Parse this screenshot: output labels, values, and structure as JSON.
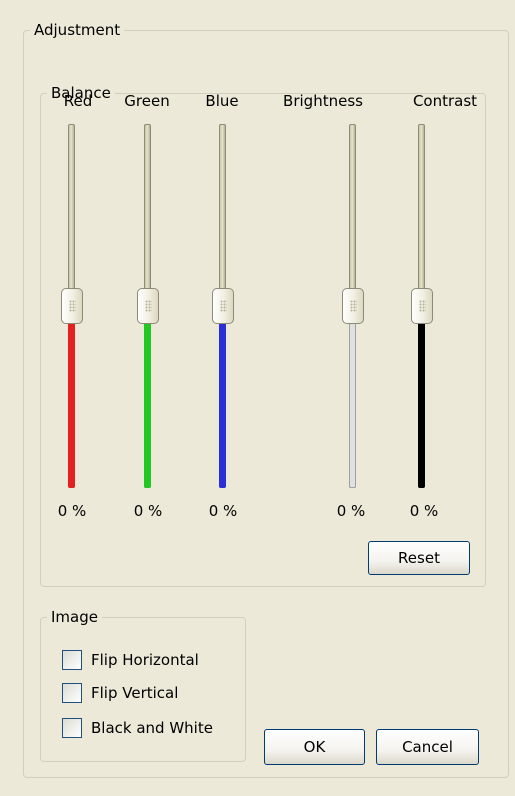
{
  "adjustment": {
    "title": "Adjustment",
    "balance": {
      "title": "Balance",
      "channels": [
        {
          "label": "Red",
          "value_text": "0 %",
          "value_percent": 0,
          "fill_color": "#e52020"
        },
        {
          "label": "Green",
          "value_text": "0 %",
          "value_percent": 0,
          "fill_color": "#22c722"
        },
        {
          "label": "Blue",
          "value_text": "0 %",
          "value_percent": 0,
          "fill_color": "#2a2fd8"
        },
        {
          "label": "Brightness",
          "value_text": "0 %",
          "value_percent": 0,
          "fill_color": "#e0e0e0"
        },
        {
          "label": "Contrast",
          "value_text": "0 %",
          "value_percent": 0,
          "fill_color": "#000000"
        }
      ],
      "reset_label": "Reset"
    },
    "image": {
      "title": "Image",
      "options": [
        {
          "label": "Flip Horizontal",
          "checked": false
        },
        {
          "label": "Flip Vertical",
          "checked": false
        },
        {
          "label": "Black and White",
          "checked": false
        }
      ]
    },
    "ok_label": "OK",
    "cancel_label": "Cancel"
  }
}
